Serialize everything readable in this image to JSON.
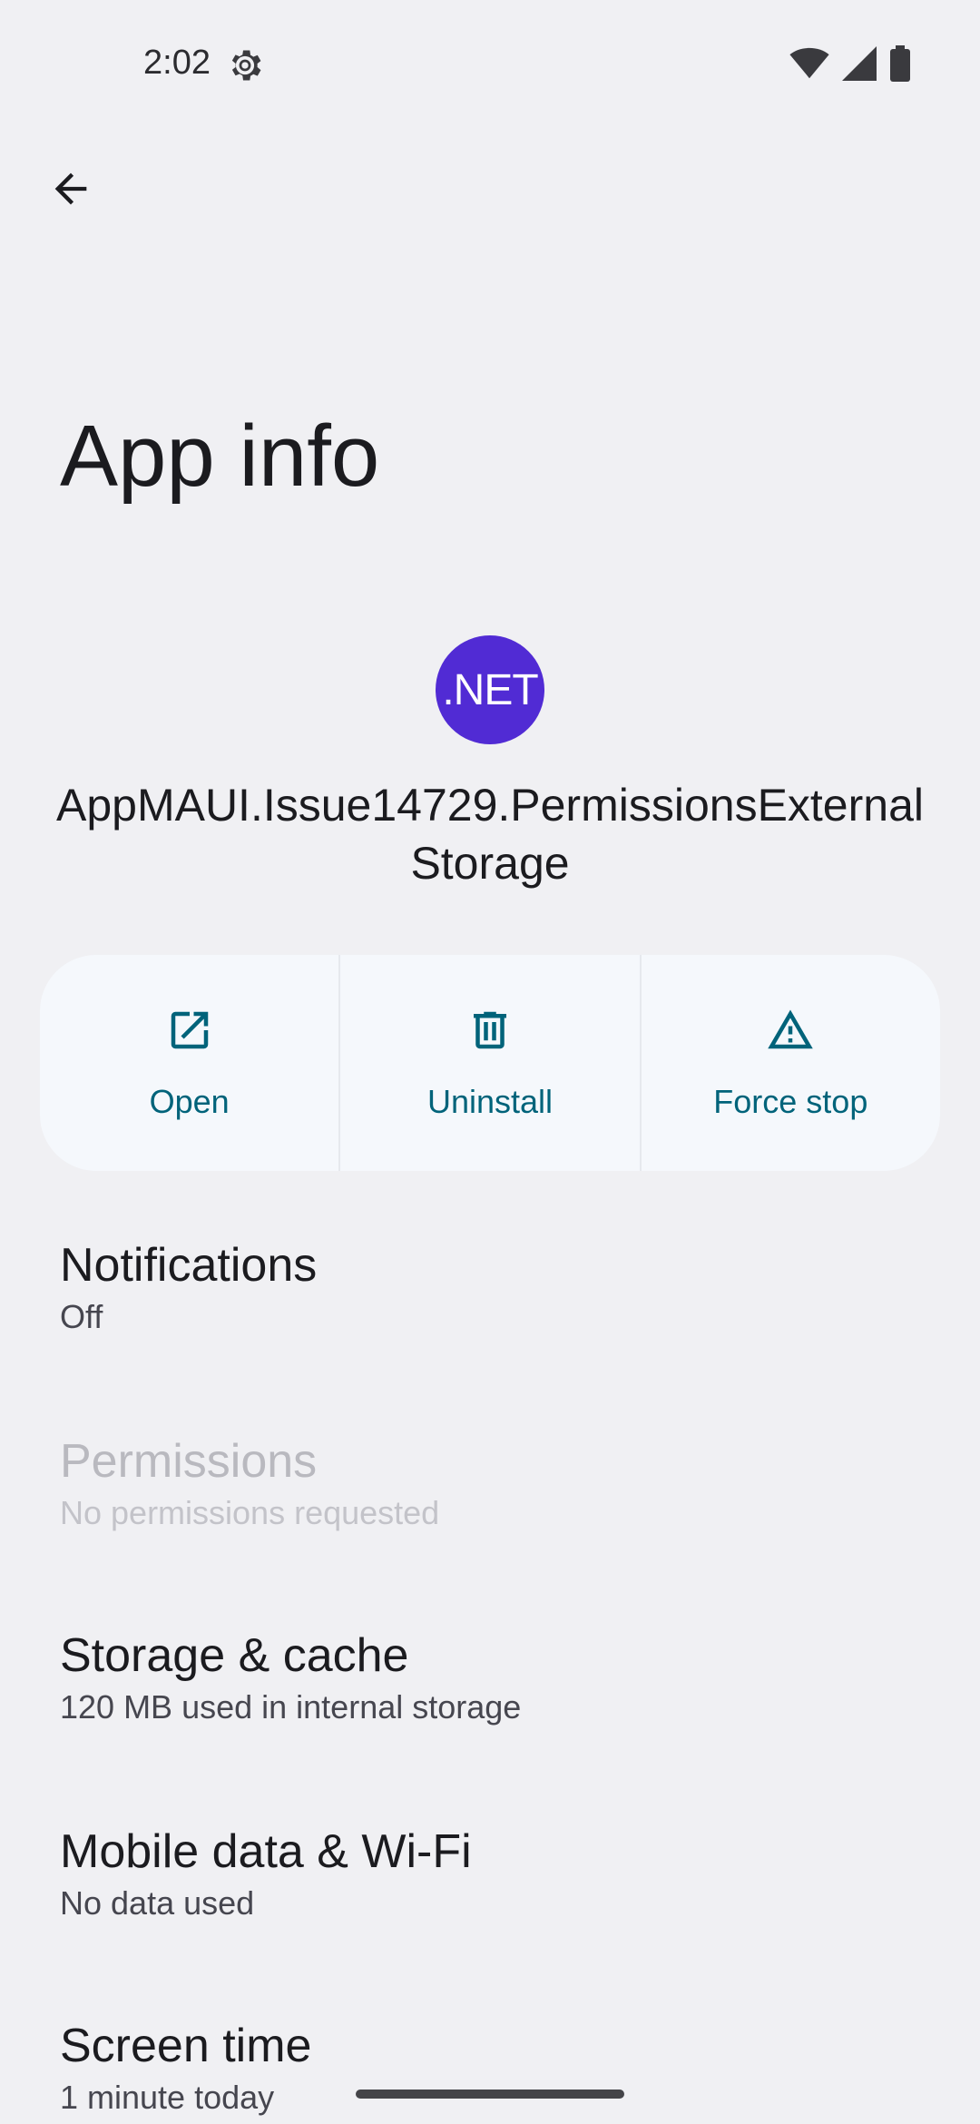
{
  "status_bar": {
    "time": "2:02",
    "icons": [
      "settings-gear-icon",
      "wifi-icon",
      "cellular-signal-icon",
      "battery-icon"
    ]
  },
  "header": {
    "back_icon": "arrow-back-icon",
    "title": "App info"
  },
  "app": {
    "icon_text": ".NET",
    "icon_color": "#512bd4",
    "name": "AppMAUI.Issue14729.PermissionsExternalStorage"
  },
  "actions": [
    {
      "label": "Open",
      "icon": "open-external-icon"
    },
    {
      "label": "Uninstall",
      "icon": "trash-icon"
    },
    {
      "label": "Force stop",
      "icon": "warning-triangle-icon"
    }
  ],
  "settings": [
    {
      "title": "Notifications",
      "summary": "Off",
      "enabled": true
    },
    {
      "title": "Permissions",
      "summary": "No permissions requested",
      "enabled": false
    },
    {
      "title": "Storage & cache",
      "summary": "120 MB used in internal storage",
      "enabled": true
    },
    {
      "title": "Mobile data & Wi-Fi",
      "summary": "No data used",
      "enabled": true
    },
    {
      "title": "Screen time",
      "summary": "1 minute today",
      "enabled": true
    }
  ],
  "colors": {
    "background": "#f0f0f3",
    "accent": "#00637a",
    "action_panel": "#f5f8fc"
  }
}
